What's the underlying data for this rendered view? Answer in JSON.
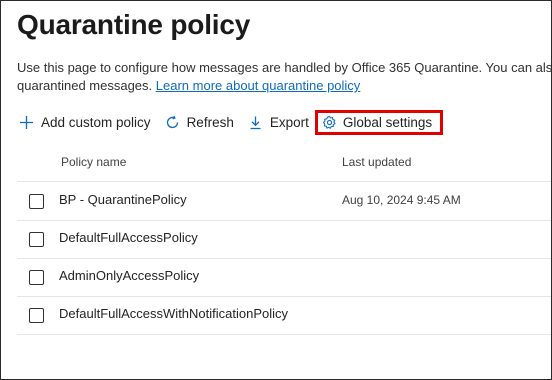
{
  "page": {
    "title": "Quarantine policy",
    "description_line1": "Use this page to configure how messages are handled by Office 365 Quarantine. You can also configure",
    "description_line2": "quarantined messages.",
    "learn_more_link": "Learn more about quarantine policy"
  },
  "toolbar": {
    "add_custom_policy": "Add custom policy",
    "refresh": "Refresh",
    "export": "Export",
    "global_settings": "Global settings"
  },
  "table": {
    "columns": [
      "Policy name",
      "Last updated"
    ],
    "rows": [
      {
        "name": "BP - QuarantinePolicy",
        "updated": "Aug 10, 2024 9:45 AM"
      },
      {
        "name": "DefaultFullAccessPolicy",
        "updated": ""
      },
      {
        "name": "AdminOnlyAccessPolicy",
        "updated": ""
      },
      {
        "name": "DefaultFullAccessWithNotificationPolicy",
        "updated": ""
      }
    ]
  },
  "colors": {
    "link": "#0f6cbd",
    "highlight_box": "#e00000",
    "icon": "#0f6cbd"
  }
}
